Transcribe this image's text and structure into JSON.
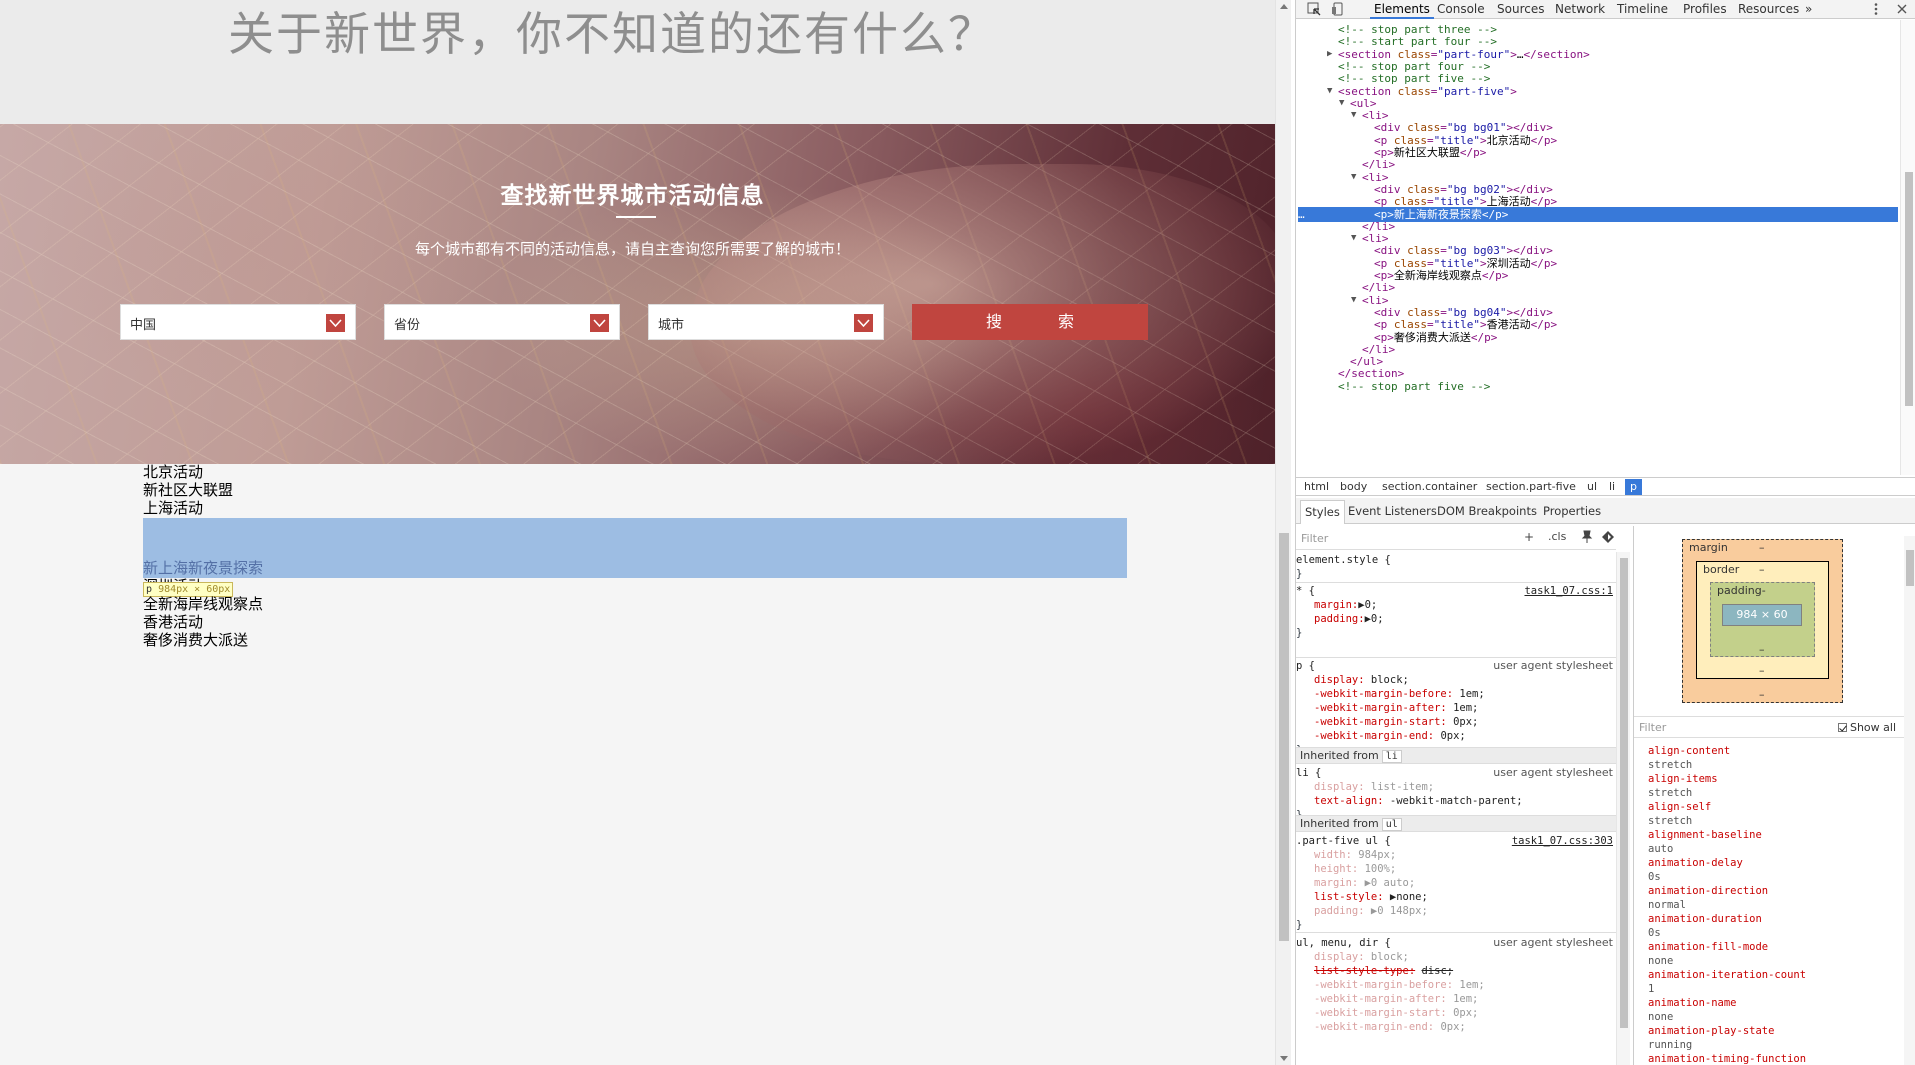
{
  "site": {
    "top_heading": "关于新世界，你不知道的还有什么？",
    "hero_title": "查找新世界城市活动信息",
    "hero_subtitle": "每个城市都有不同的活动信息，请自主查询您所需要了解的城市！",
    "select_country": "中国",
    "select_province": "省份",
    "select_city": "城市",
    "search_label": "搜　索",
    "events": [
      "北京活动",
      "新社区大联盟",
      "上海活动"
    ],
    "highlighted_event": "新上海新夜景探索",
    "ghost_text": "深圳活动",
    "events_after": [
      "全新海岸线观察点",
      "香港活动",
      "奢侈消费大派送"
    ],
    "inspect_tag": "p",
    "inspect_size": "984px × 60px"
  },
  "devtools": {
    "tabs": [
      "Elements",
      "Console",
      "Sources",
      "Network",
      "Timeline",
      "Profiles",
      "Resources"
    ],
    "more_tabs": "»",
    "tree": [
      "<!-- stop part three -->",
      "<!-- start part four -->",
      "<section class=\"part-four\">…</section>",
      "<!-- stop part four -->",
      "<!-- stop part five -->",
      "<section class=\"part-five\">",
      "<ul>",
      "<li>",
      "<div class=\"bg bg01\"></div>",
      "<p class=\"title\">北京活动</p>",
      "<p>新社区大联盟</p>",
      "</li>",
      "<li>",
      "<div class=\"bg bg02\"></div>",
      "<p class=\"title\">上海活动</p>",
      "<p>新上海新夜景探索</p>",
      "</li>",
      "<li>",
      "<div class=\"bg bg03\"></div>",
      "<p class=\"title\">深圳活动</p>",
      "<p>全新海岸线观察点</p>",
      "</li>",
      "<li>",
      "<div class=\"bg bg04\"></div>",
      "<p class=\"title\">香港活动</p>",
      "<p>奢侈消费大派送</p>",
      "</li>",
      "</ul>",
      "</section>",
      "<!-- stop part five -->"
    ],
    "selected_marker": "…",
    "breadcrumbs": [
      "html",
      "body",
      "section.container",
      "section.part-five",
      "ul",
      "li",
      "p"
    ],
    "styles_tabs": [
      "Styles",
      "Event Listeners",
      "DOM Breakpoints",
      "Properties"
    ],
    "styles_filter_placeholder": "Filter",
    "add_rule": "+",
    "cls_toggle": ".cls",
    "rules": {
      "element_style": "element.style {",
      "universal_selector": "* {",
      "universal_source": "task1_07.css:1",
      "margin_decl": "margin:",
      "margin_val": "▶0;",
      "padding_decl": "padding:",
      "padding_val": "▶0;",
      "p_selector": "p {",
      "ua_label": "user agent stylesheet",
      "p_decls": [
        [
          "display:",
          "block;"
        ],
        [
          "-webkit-margin-before:",
          "1em;"
        ],
        [
          "-webkit-margin-after:",
          "1em;"
        ],
        [
          "-webkit-margin-start:",
          "0px;"
        ],
        [
          "-webkit-margin-end:",
          "0px;"
        ]
      ],
      "inherited_li": "Inherited from",
      "inherited_li_tag": "li",
      "li_selector": "li {",
      "li_decls": [
        [
          "display:",
          "list-item;"
        ],
        [
          "text-align:",
          "-webkit-match-parent;"
        ]
      ],
      "inherited_ul": "Inherited from",
      "inherited_ul_tag": "ul",
      "partfive_selector": ".part-five ul {",
      "partfive_source": "task1_07.css:303",
      "partfive_decls": [
        [
          "width:",
          "984px;"
        ],
        [
          "height:",
          "100%;"
        ],
        [
          "margin:",
          "▶0 auto;"
        ],
        [
          "list-style:",
          "▶none;"
        ],
        [
          "padding:",
          "▶0 148px;"
        ]
      ],
      "ul_selector": "ul, menu, dir {",
      "ul_decls": [
        [
          "display:",
          "block;"
        ],
        [
          "list-style-type:",
          "disc;"
        ],
        [
          "-webkit-margin-before:",
          "1em;"
        ],
        [
          "-webkit-margin-after:",
          "1em;"
        ],
        [
          "-webkit-margin-start:",
          "0px;"
        ],
        [
          "-webkit-margin-end:",
          "0px;"
        ]
      ],
      "close": "}"
    },
    "box_model": {
      "margin_label": "margin",
      "border_label": "border",
      "padding_label": "padding-",
      "content_size": "984 × 60",
      "dash": "–"
    },
    "computed_filter_placeholder": "Filter",
    "show_all": "Show all",
    "computed": [
      [
        "align-content",
        "stretch"
      ],
      [
        "align-items",
        "stretch"
      ],
      [
        "align-self",
        "stretch"
      ],
      [
        "alignment-baseline",
        "auto"
      ],
      [
        "animation-delay",
        "0s"
      ],
      [
        "animation-direction",
        "normal"
      ],
      [
        "animation-duration",
        "0s"
      ],
      [
        "animation-fill-mode",
        "none"
      ],
      [
        "animation-iteration-count",
        "1"
      ],
      [
        "animation-name",
        "none"
      ],
      [
        "animation-play-state",
        "running"
      ],
      [
        "animation-timing-function",
        ""
      ]
    ]
  },
  "colors": {
    "accent_red": "#c0453f",
    "devtools_selection": "#3879d9",
    "highlight_blue": "#78a5dc"
  }
}
